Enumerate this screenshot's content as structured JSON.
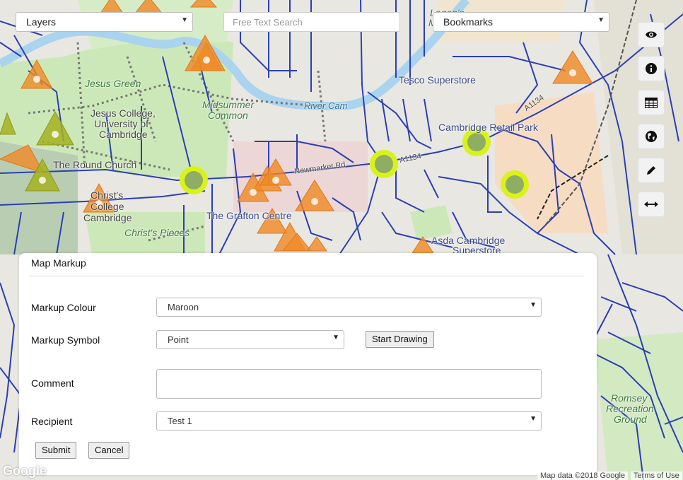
{
  "toolbar": {
    "layers_label": "Layers",
    "search_placeholder": "Free Text Search",
    "bookmarks_label": "Bookmarks"
  },
  "side_tools": [
    {
      "icon": "eye-icon"
    },
    {
      "icon": "info-icon"
    },
    {
      "icon": "table-icon"
    },
    {
      "icon": "globe-icon"
    },
    {
      "icon": "pencil-icon"
    },
    {
      "icon": "measure-icon"
    }
  ],
  "map": {
    "labels": {
      "jesus_green": "Jesus Green",
      "jesus_college_1": "Jesus College,",
      "jesus_college_2": "University of",
      "jesus_college_3": "Cambridge",
      "round_church": "The Round Church",
      "christs_college_1": "Christ's",
      "christs_college_2": "College",
      "christs_college_3": "Cambridge",
      "christs_pieces": "Christ's Pieces",
      "midsummer_1": "Midsummer",
      "midsummer_2": "Common",
      "river_cam": "River Cam",
      "tesco": "Tesco Superstore",
      "retail_park": "Cambridge Retail Park",
      "grafton": "The Grafton Centre",
      "asda_1": "Asda Cambridge",
      "asda_2": "Superstore",
      "newmarket": "Newmarket Rd",
      "a1134": "A1134",
      "a1134_b": "A1134",
      "romsey_1": "Romsey",
      "romsey_2": "Recreation",
      "romsey_3": "Ground",
      "logans_1": "Logan's",
      "logans_2": "Mea"
    },
    "attribution": "Map data ©2018 Google",
    "terms": "Terms of Use",
    "google_logo": "Google"
  },
  "panel": {
    "title": "Map Markup",
    "colour_label": "Markup Colour",
    "colour_value": "Maroon",
    "symbol_label": "Markup Symbol",
    "symbol_value": "Point",
    "start_drawing": "Start Drawing",
    "comment_label": "Comment",
    "comment_value": "",
    "recipient_label": "Recipient",
    "recipient_value": "Test 1",
    "submit": "Submit",
    "cancel": "Cancel"
  },
  "colors": {
    "road": "#2b3fb3",
    "park": "#c8e6b4",
    "river": "#a9d3ee",
    "marker_orange": "#f08a24",
    "marker_olive": "#a3b120",
    "marker_circle": "#d9f21a"
  }
}
